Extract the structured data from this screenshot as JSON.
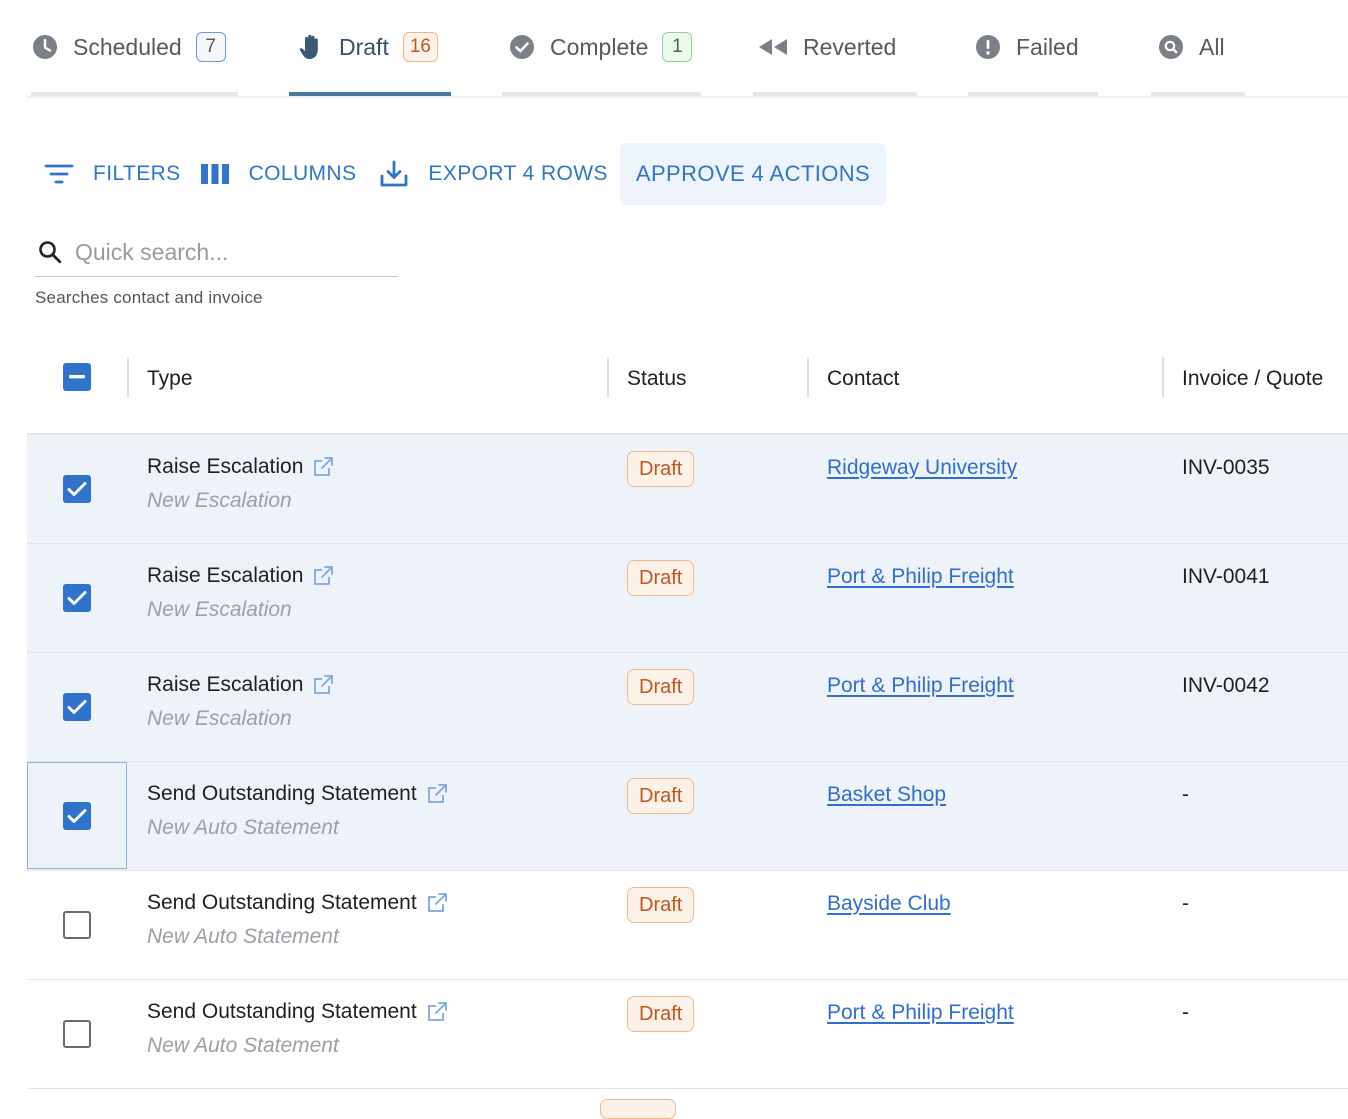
{
  "tabs": [
    {
      "label": "Scheduled",
      "count": "7",
      "icon": "clock-icon"
    },
    {
      "label": "Draft",
      "count": "16",
      "icon": "hand-icon"
    },
    {
      "label": "Complete",
      "count": "1",
      "icon": "check-circle-icon"
    },
    {
      "label": "Reverted",
      "icon": "rewind-icon"
    },
    {
      "label": "Failed",
      "icon": "exclamation-circle-icon"
    },
    {
      "label": "All",
      "icon": "search-circle-icon"
    }
  ],
  "active_tab": "Draft",
  "toolbar": {
    "filters_label": "FILTERS",
    "columns_label": "COLUMNS",
    "export_label": "EXPORT 4 ROWS",
    "approve_label": "APPROVE 4 ACTIONS"
  },
  "search": {
    "placeholder": "Quick search...",
    "helper": "Searches contact and invoice"
  },
  "table": {
    "headers": {
      "type": "Type",
      "status": "Status",
      "contact": "Contact",
      "invoice": "Invoice / Quote"
    },
    "rows": [
      {
        "selected": true,
        "type": "Raise Escalation",
        "subtype": "New Escalation",
        "status": "Draft",
        "contact": "Ridgeway University",
        "invoice": "INV-0035"
      },
      {
        "selected": true,
        "type": "Raise Escalation",
        "subtype": "New Escalation",
        "status": "Draft",
        "contact": "Port & Philip Freight",
        "invoice": "INV-0041"
      },
      {
        "selected": true,
        "type": "Raise Escalation",
        "subtype": "New Escalation",
        "status": "Draft",
        "contact": "Port & Philip Freight",
        "invoice": "INV-0042"
      },
      {
        "selected": true,
        "type": "Send Outstanding Statement",
        "subtype": "New Auto Statement",
        "status": "Draft",
        "contact": "Basket Shop",
        "invoice": "-"
      },
      {
        "selected": false,
        "type": "Send Outstanding Statement",
        "subtype": "New Auto Statement",
        "status": "Draft",
        "contact": "Bayside Club",
        "invoice": "-"
      },
      {
        "selected": false,
        "type": "Send Outstanding Statement",
        "subtype": "New Auto Statement",
        "status": "Draft",
        "contact": "Port & Philip Freight",
        "invoice": "-"
      }
    ]
  },
  "colors": {
    "accent_blue": "#2f75c9",
    "active_tab": "#4a7a9e",
    "draft_badge": "#c0571f",
    "selected_row": "#eef3fa"
  }
}
